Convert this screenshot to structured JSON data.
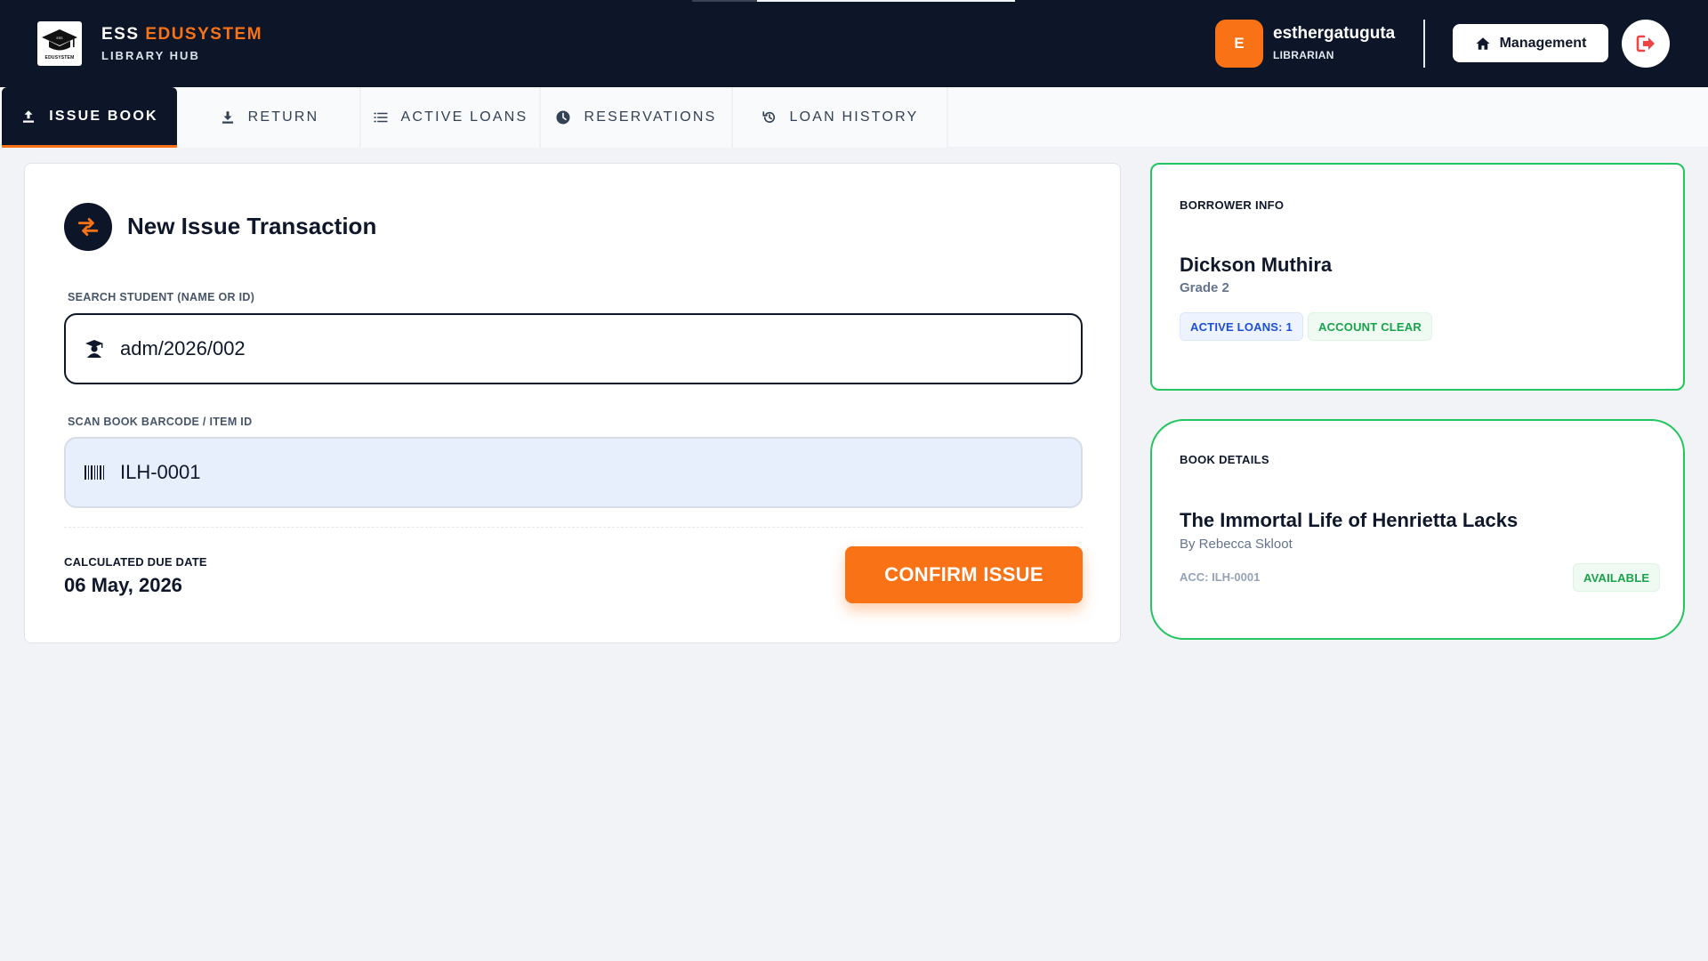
{
  "header": {
    "brand_prefix": "ESS",
    "brand_accent": "EDUSYSTEM",
    "brand_sub": "LIBRARY HUB",
    "logo_text": "EDUSYSTEM",
    "avatar_letter": "E",
    "user_name": "esthergatuguta",
    "user_role": "LIBRARIAN",
    "management_label": "Management"
  },
  "tabs": [
    {
      "label": "ISSUE BOOK",
      "icon": "upload-icon",
      "active": true
    },
    {
      "label": "RETURN",
      "icon": "download-icon",
      "active": false
    },
    {
      "label": "ACTIVE LOANS",
      "icon": "list-icon",
      "active": false
    },
    {
      "label": "RESERVATIONS",
      "icon": "clock-icon",
      "active": false
    },
    {
      "label": "LOAN HISTORY",
      "icon": "history-icon",
      "active": false
    }
  ],
  "transaction": {
    "title": "New Issue Transaction",
    "student_label": "SEARCH STUDENT (NAME OR ID)",
    "student_value": "adm/2026/002",
    "book_label": "SCAN BOOK BARCODE / ITEM ID",
    "book_value": "ILH-0001",
    "due_label": "CALCULATED DUE DATE",
    "due_value": "06 May, 2026",
    "confirm_label": "CONFIRM ISSUE"
  },
  "borrower": {
    "label": "BORROWER INFO",
    "name": "Dickson Muthira",
    "grade": "Grade 2",
    "active_loans": "ACTIVE LOANS: 1",
    "account_status": "ACCOUNT CLEAR"
  },
  "book": {
    "label": "BOOK DETAILS",
    "title": "The Immortal Life of Henrietta Lacks",
    "author": "By Rebecca Skloot",
    "acc": "ACC: ILH-0001",
    "status": "AVAILABLE"
  },
  "colors": {
    "header_bg": "#0d1628",
    "accent": "#f97316",
    "success": "#22c55e",
    "info": "#1d4ed8"
  }
}
